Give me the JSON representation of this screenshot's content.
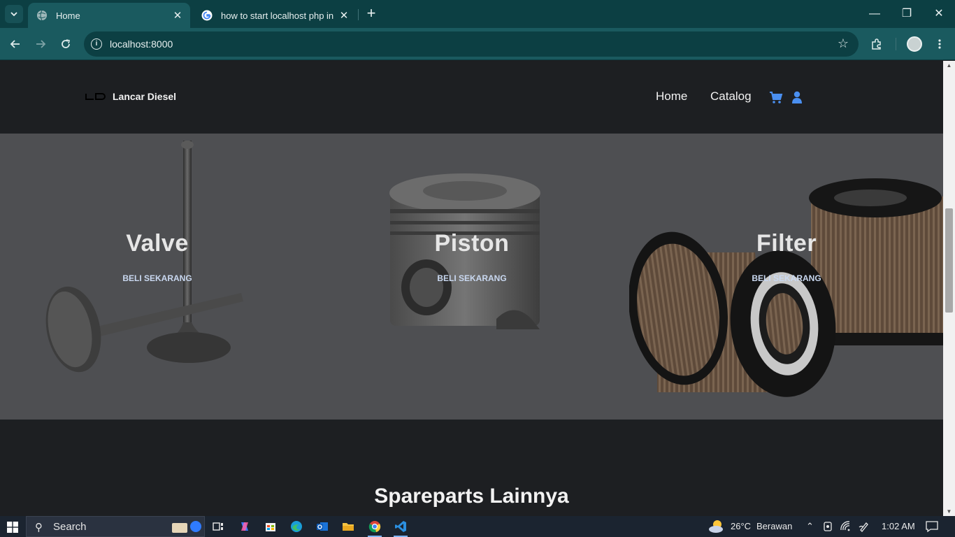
{
  "browser": {
    "tabs": [
      {
        "title": "Home",
        "active": true
      },
      {
        "title": "how to start localhost php in vs",
        "active": false
      }
    ],
    "url": "localhost:8000"
  },
  "site": {
    "brand": "Lancar Diesel",
    "nav": [
      {
        "label": "Home"
      },
      {
        "label": "Catalog"
      }
    ],
    "hero_cards": [
      {
        "title": "Valve",
        "cta": "BELI SEKARANG"
      },
      {
        "title": "Piston",
        "cta": "BELI SEKARANG"
      },
      {
        "title": "Filter",
        "cta": "BELI SEKARANG"
      }
    ],
    "section_title": "Spareparts Lainnya"
  },
  "taskbar": {
    "search_placeholder": "Search",
    "weather_temp": "26°C",
    "weather_text": "Berawan",
    "time": "1:02 AM"
  },
  "colors": {
    "accent": "#4a8ff0",
    "header_bg": "#1d1f22",
    "hero_overlay": "#4e4f52"
  }
}
